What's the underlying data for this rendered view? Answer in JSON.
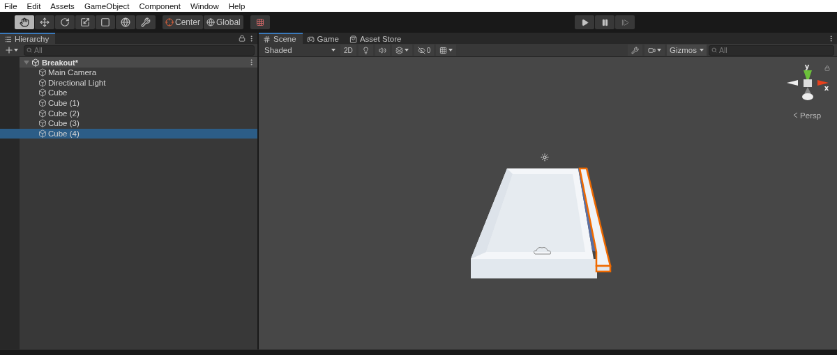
{
  "menu": [
    "File",
    "Edit",
    "Assets",
    "GameObject",
    "Component",
    "Window",
    "Help"
  ],
  "tools": [
    {
      "kind": "hand",
      "selected": true
    },
    {
      "kind": "move",
      "selected": false
    },
    {
      "kind": "rotate",
      "selected": false
    },
    {
      "kind": "scale",
      "selected": false
    },
    {
      "kind": "rect",
      "selected": false
    },
    {
      "kind": "transform",
      "selected": false
    },
    {
      "kind": "custom",
      "selected": false
    }
  ],
  "pivot": {
    "position": "Center",
    "rotation": "Global"
  },
  "hierarchy": {
    "title": "Hierarchy",
    "search": {
      "placeholder": "All"
    },
    "scene": {
      "name": "Breakout*",
      "expanded": true,
      "children": [
        {
          "name": "Main Camera",
          "selected": false
        },
        {
          "name": "Directional Light",
          "selected": false
        },
        {
          "name": "Cube",
          "selected": false
        },
        {
          "name": "Cube (1)",
          "selected": false
        },
        {
          "name": "Cube (2)",
          "selected": false
        },
        {
          "name": "Cube (3)",
          "selected": false
        },
        {
          "name": "Cube (4)",
          "selected": true
        }
      ]
    }
  },
  "scene_view": {
    "tabs": [
      {
        "kind": "scene",
        "label": "Scene",
        "selected": true
      },
      {
        "kind": "game",
        "label": "Game",
        "selected": false
      },
      {
        "kind": "store",
        "label": "Asset Store",
        "selected": false
      }
    ],
    "toolbar": {
      "shading": "Shaded",
      "mode": "2D",
      "hidden_count": "0",
      "gizmos": "Gizmos",
      "search": {
        "placeholder": "All"
      }
    },
    "gizmo": {
      "y_label": "y",
      "x_label": "x",
      "projection": "Persp"
    }
  }
}
